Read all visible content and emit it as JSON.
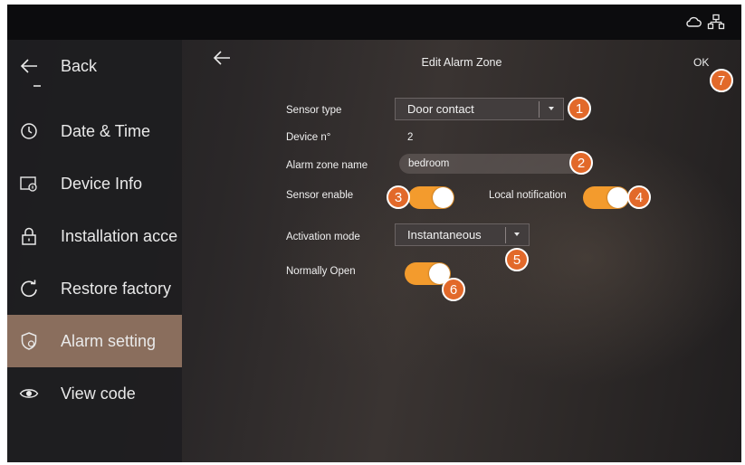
{
  "sidebar": {
    "items": [
      {
        "label": "Back",
        "icon": "arrow-left-icon"
      },
      {
        "label": "Date & Time",
        "icon": "clock-icon"
      },
      {
        "label": "Device Info",
        "icon": "device-info-icon"
      },
      {
        "label": "Installation acce",
        "icon": "lock-icon"
      },
      {
        "label": "Restore factory",
        "icon": "refresh-icon"
      },
      {
        "label": "Alarm setting",
        "icon": "shield-icon"
      },
      {
        "label": "View code",
        "icon": "eye-icon"
      }
    ],
    "active_index": 5
  },
  "header": {
    "title": "Edit Alarm Zone",
    "ok_label": "OK"
  },
  "form": {
    "sensor_type": {
      "label": "Sensor type",
      "value": "Door contact"
    },
    "device_no": {
      "label": "Device n°",
      "value": "2"
    },
    "alarm_zone_name": {
      "label": "Alarm zone name",
      "value": "bedroom"
    },
    "sensor_enable": {
      "label": "Sensor enable",
      "on": true
    },
    "local_notification": {
      "label": "Local notification",
      "on": true
    },
    "activation_mode": {
      "label": "Activation mode",
      "value": "Instantaneous"
    },
    "normally_open": {
      "label": "Normally Open",
      "on": true
    }
  },
  "badges": [
    "1",
    "2",
    "3",
    "4",
    "5",
    "6",
    "7"
  ],
  "colors": {
    "accent": "#f39b2d",
    "badge": "#e2692a",
    "active_item": "#8a6e5d"
  }
}
